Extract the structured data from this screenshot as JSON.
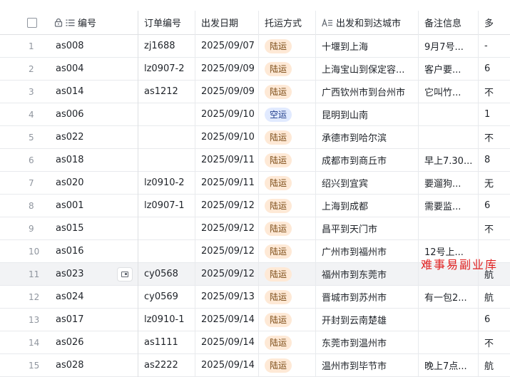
{
  "columns": [
    {
      "key": "id",
      "label": "编号"
    },
    {
      "key": "order",
      "label": "订单编号"
    },
    {
      "key": "date",
      "label": "出发日期"
    },
    {
      "key": "mode",
      "label": "托运方式"
    },
    {
      "key": "route",
      "label": "出发和到达城市"
    },
    {
      "key": "note",
      "label": "备注信息"
    },
    {
      "key": "extra",
      "label": "多"
    }
  ],
  "rows": [
    {
      "n": "1",
      "id": "as008",
      "order": "zj1688",
      "date": "2025/09/07",
      "mode": "陆运",
      "route": "十堰到上海",
      "note": "9月7号...",
      "extra": "-"
    },
    {
      "n": "2",
      "id": "as004",
      "order": "lz0907-2",
      "date": "2025/09/09",
      "mode": "陆运",
      "route": "上海宝山到保定容...",
      "note": "客户要...",
      "extra": "6"
    },
    {
      "n": "3",
      "id": "as014",
      "order": "as1212",
      "date": "2025/09/09",
      "mode": "陆运",
      "route": "广西钦州市到台州市",
      "note": "它叫竹...",
      "extra": "不"
    },
    {
      "n": "4",
      "id": "as006",
      "order": "",
      "date": "2025/09/10",
      "mode": "空运",
      "route": "昆明到山南",
      "note": "",
      "extra": "1"
    },
    {
      "n": "5",
      "id": "as022",
      "order": "",
      "date": "2025/09/10",
      "mode": "陆运",
      "route": "承德市到哈尔滨",
      "note": "",
      "extra": "不"
    },
    {
      "n": "6",
      "id": "as018",
      "order": "",
      "date": "2025/09/11",
      "mode": "陆运",
      "route": "成都市到商丘市",
      "note": "早上7.30...",
      "extra": "8"
    },
    {
      "n": "7",
      "id": "as020",
      "order": "lz0910-2",
      "date": "2025/09/11",
      "mode": "陆运",
      "route": "绍兴到宜宾",
      "note": "要遛狗...",
      "extra": "无"
    },
    {
      "n": "8",
      "id": "as001",
      "order": "lz0907-1",
      "date": "2025/09/12",
      "mode": "陆运",
      "route": "上海到成都",
      "note": "需要监...",
      "extra": "6"
    },
    {
      "n": "9",
      "id": "as015",
      "order": "",
      "date": "2025/09/12",
      "mode": "陆运",
      "route": "昌平到天门市",
      "note": "",
      "extra": "不"
    },
    {
      "n": "10",
      "id": "as016",
      "order": "",
      "date": "2025/09/12",
      "mode": "陆运",
      "route": "广州市到福州市",
      "note": "12号上...",
      "extra": ""
    },
    {
      "n": "11",
      "id": "as023",
      "order": "cy0568",
      "date": "2025/09/12",
      "mode": "陆运",
      "route": "福州市到东莞市",
      "note": "",
      "extra": "航"
    },
    {
      "n": "12",
      "id": "as024",
      "order": "cy0569",
      "date": "2025/09/13",
      "mode": "陆运",
      "route": "晋城市到苏州市",
      "note": "有一包2...",
      "extra": "航"
    },
    {
      "n": "13",
      "id": "as017",
      "order": "lz0910-1",
      "date": "2025/09/14",
      "mode": "陆运",
      "route": "开封到云南楚雄",
      "note": "",
      "extra": "6"
    },
    {
      "n": "14",
      "id": "as026",
      "order": "as1111",
      "date": "2025/09/14",
      "mode": "陆运",
      "route": "东莞市到温州市",
      "note": "",
      "extra": "不"
    },
    {
      "n": "15",
      "id": "as028",
      "order": "as2222",
      "date": "2025/09/14",
      "mode": "陆运",
      "route": "温州市到毕节市",
      "note": "晚上7点...",
      "extra": "航"
    }
  ],
  "hover_row_index": 10,
  "watermark": "难事易副业库",
  "colors": {
    "land_tag_bg": "#fee9d6",
    "air_tag_bg": "#e1eaff",
    "hover_bg": "#f2f3f5"
  },
  "icons": {
    "id_column": [
      "lock-icon",
      "list-icon"
    ],
    "route_column": "text-field-icon"
  }
}
